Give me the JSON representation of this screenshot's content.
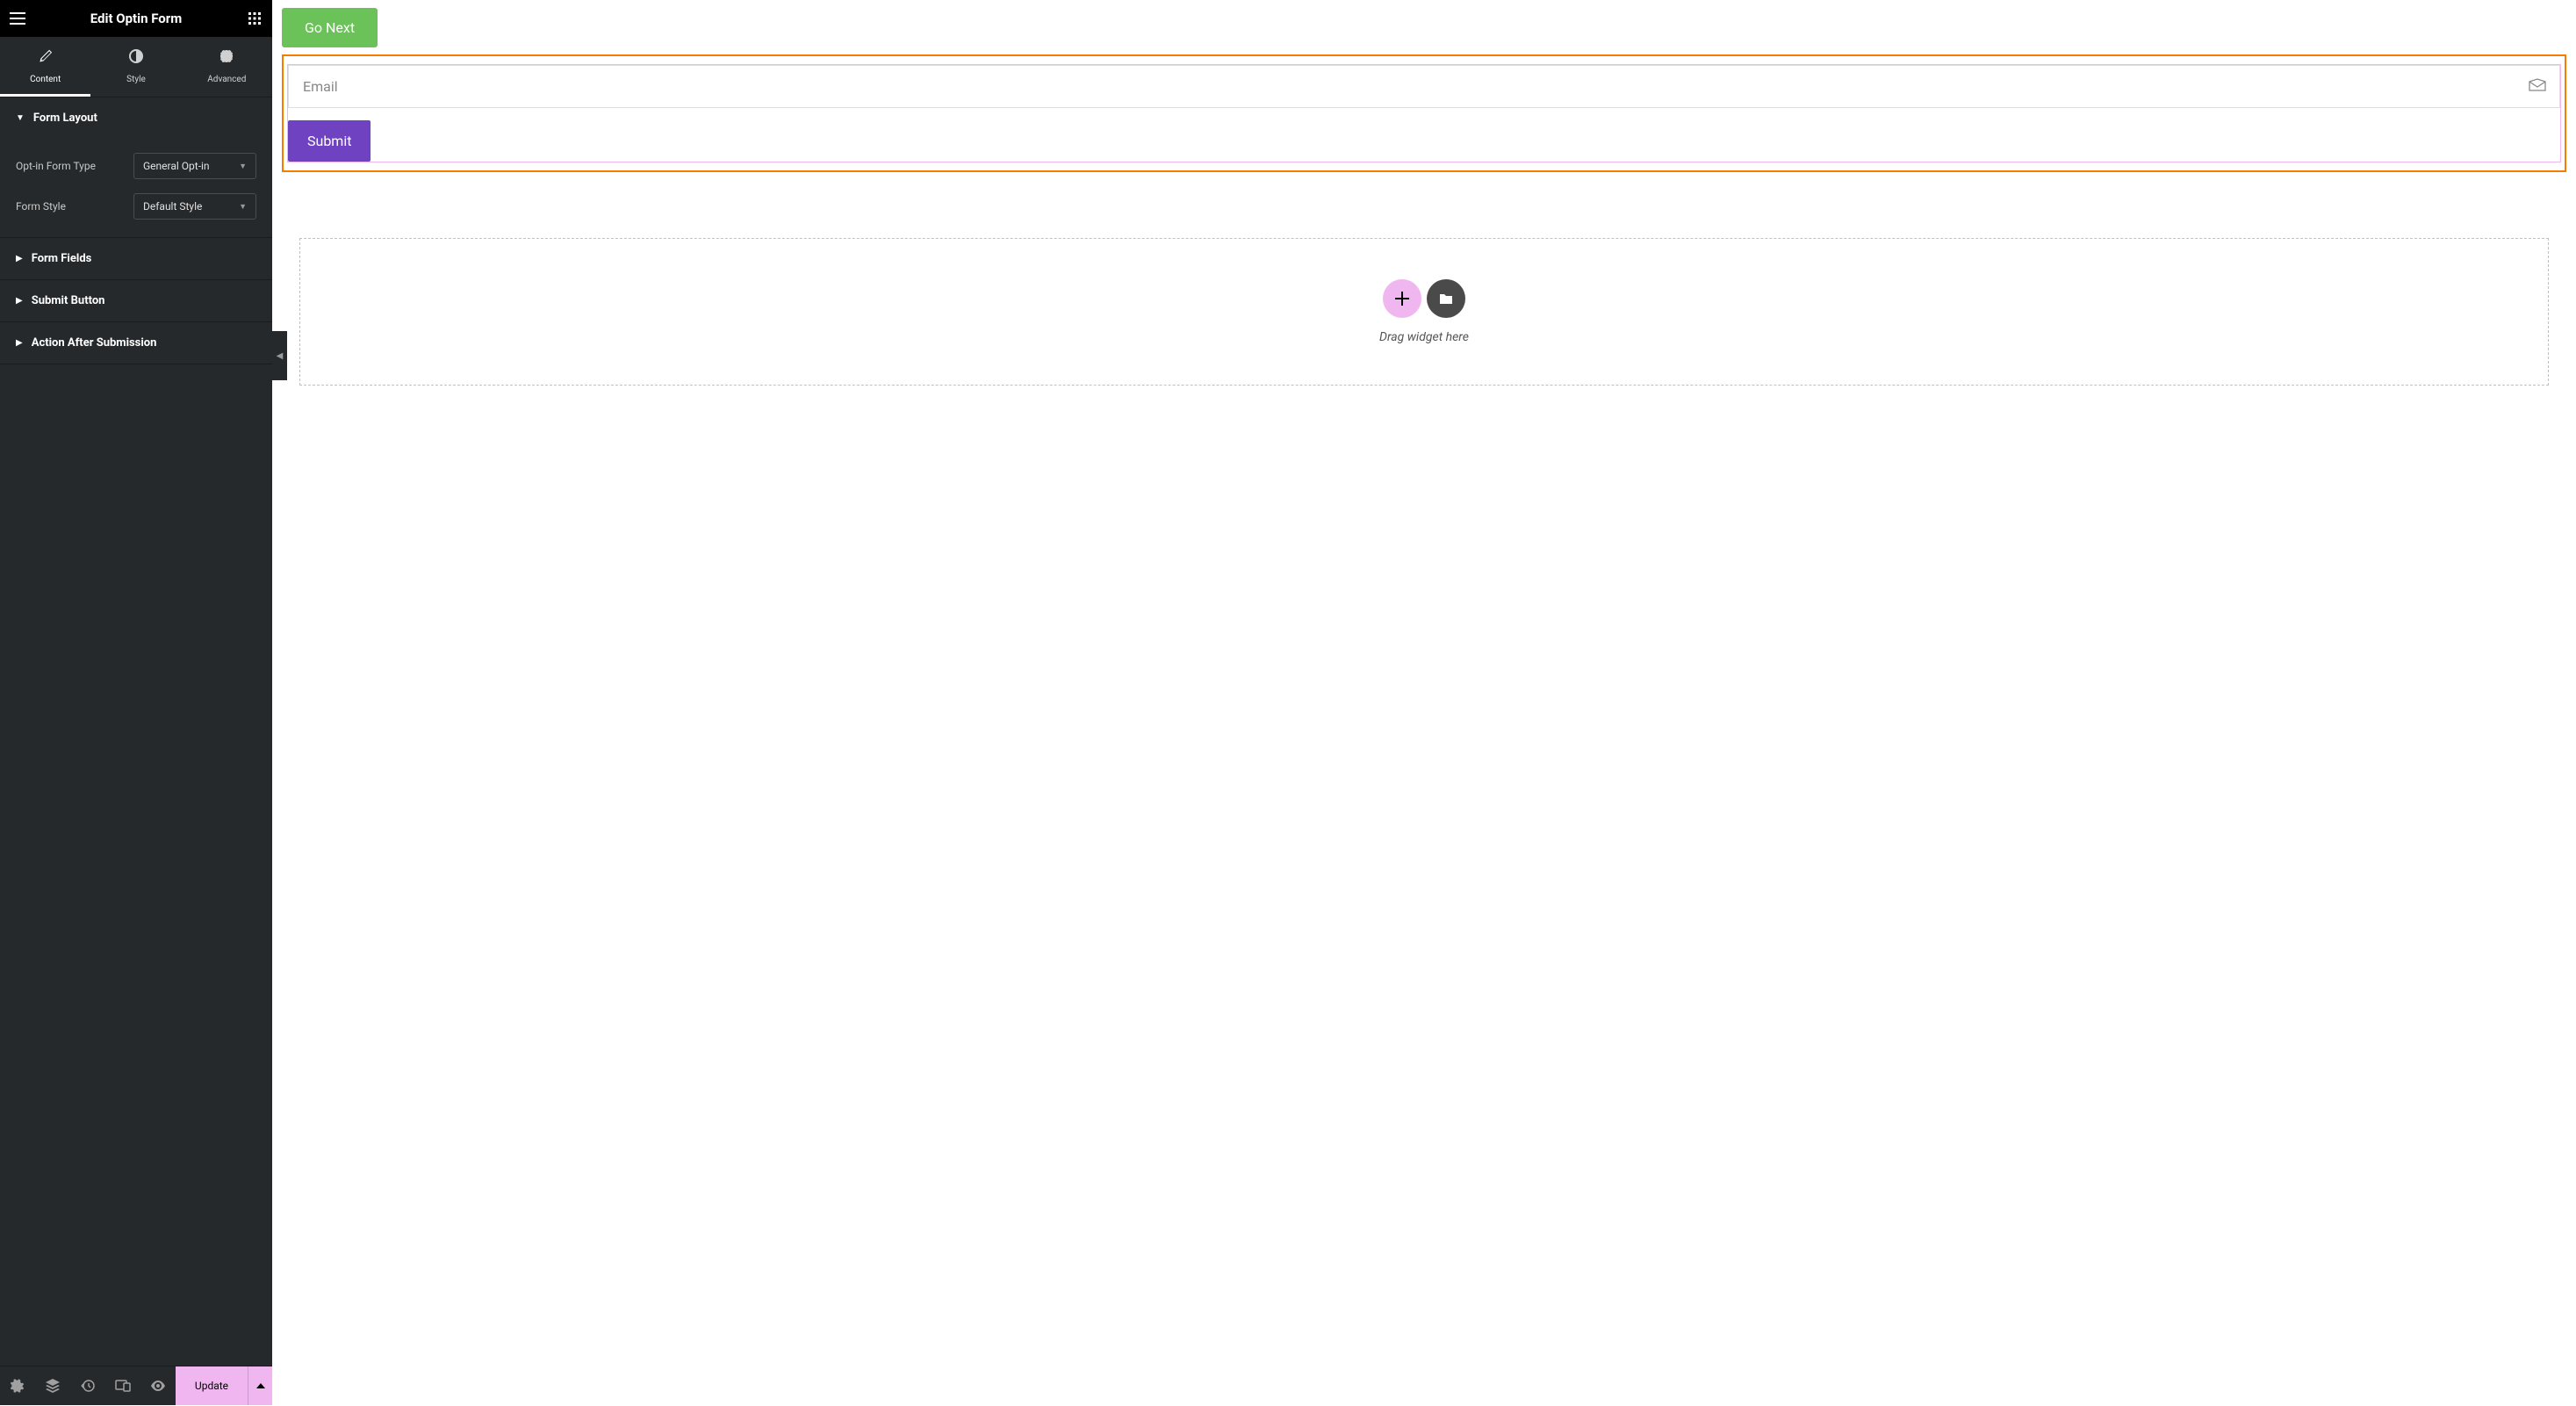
{
  "sidebar": {
    "title": "Edit Optin Form",
    "tabs": {
      "content": "Content",
      "style": "Style",
      "advanced": "Advanced"
    },
    "sections": {
      "form_layout": {
        "title": "Form Layout",
        "controls": {
          "form_type_label": "Opt-in Form Type",
          "form_type_value": "General Opt-in",
          "form_style_label": "Form Style",
          "form_style_value": "Default Style"
        }
      },
      "form_fields": "Form Fields",
      "submit_button": "Submit Button",
      "action_after": "Action After Submission"
    },
    "bottom": {
      "update": "Update"
    }
  },
  "canvas": {
    "go_next": "Go Next",
    "email_placeholder": "Email",
    "submit_label": "Submit",
    "drop_text": "Drag widget here"
  }
}
